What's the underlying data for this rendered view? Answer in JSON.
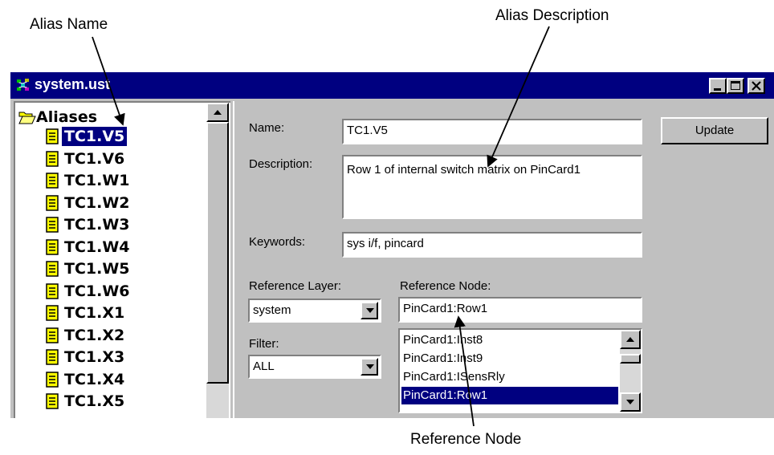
{
  "callouts": {
    "alias_name": "Alias Name",
    "alias_description": "Alias Description",
    "reference_node": "Reference Node"
  },
  "window": {
    "title": "system.ust",
    "buttons": [
      "minimize",
      "maximize",
      "close"
    ]
  },
  "tree": {
    "root_label": "Aliases",
    "items": [
      {
        "label": "TC1.V5",
        "selected": true
      },
      {
        "label": "TC1.V6"
      },
      {
        "label": "TC1.W1"
      },
      {
        "label": "TC1.W2"
      },
      {
        "label": "TC1.W3"
      },
      {
        "label": "TC1.W4"
      },
      {
        "label": "TC1.W5"
      },
      {
        "label": "TC1.W6"
      },
      {
        "label": "TC1.X1"
      },
      {
        "label": "TC1.X2"
      },
      {
        "label": "TC1.X3"
      },
      {
        "label": "TC1.X4"
      },
      {
        "label": "TC1.X5"
      }
    ]
  },
  "form": {
    "name_label": "Name:",
    "name_value": "TC1.V5",
    "description_label": "Description:",
    "description_value": "Row 1 of internal switch matrix on PinCard1",
    "keywords_label": "Keywords:",
    "keywords_value": "sys i/f, pincard",
    "reference_layer_label": "Reference Layer:",
    "reference_layer_value": "system",
    "filter_label": "Filter:",
    "filter_value": "ALL",
    "reference_node_label": "Reference Node:",
    "reference_node_value": "PinCard1:Row1",
    "node_list": [
      {
        "label": "PinCard1:Inst8"
      },
      {
        "label": "PinCard1:Inst9"
      },
      {
        "label": "PinCard1:ISensRly"
      },
      {
        "label": "PinCard1:Row1",
        "selected": true
      }
    ],
    "update_label": "Update"
  }
}
